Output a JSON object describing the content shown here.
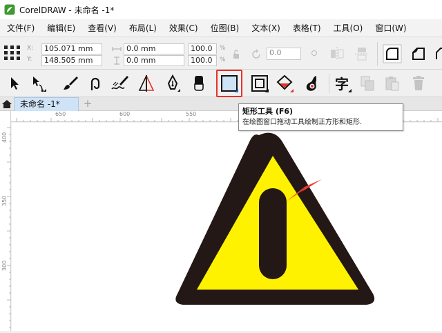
{
  "window": {
    "title": "CorelDRAW - 未命名 -1*",
    "icon": "coreldraw-logo-icon"
  },
  "menu": {
    "items": [
      "文件(F)",
      "编辑(E)",
      "查看(V)",
      "布局(L)",
      "效果(C)",
      "位图(B)",
      "文本(X)",
      "表格(T)",
      "工具(O)",
      "窗口(W)"
    ]
  },
  "property_bar": {
    "x_label": "X:",
    "y_label": "Y:",
    "x_value": "105.071 mm",
    "y_value": "148.505 mm",
    "width_value": "0.0 mm",
    "height_value": "0.0 mm",
    "scale_x": "100.0",
    "scale_y": "100.0",
    "percent": "%",
    "rotation": "0.0"
  },
  "toolbox": {
    "tools": [
      "pick-tool",
      "shape-tool",
      "artistic-media-tool",
      "freehand-tool",
      "calligraphy-tool",
      "smart-fill-tool",
      "pen-tool",
      "eraser-tool",
      "rectangle-tool",
      "contour-tool",
      "interactive-fill-tool",
      "smart-drawing-tool",
      "text-tool",
      "copy-properties-tool",
      "paste-tool",
      "delete-tool"
    ],
    "active_tool": "rectangle-tool",
    "highlight_color": "#e8302a"
  },
  "tabs": {
    "document": "未命名 -1*",
    "add_label": "+"
  },
  "rulers": {
    "horizontal_labels": [
      "650",
      "600",
      "550"
    ],
    "vertical_labels": [
      "400",
      "350",
      "300"
    ]
  },
  "tooltip": {
    "title": "矩形工具 (F6)",
    "description": "在绘图窗口拖动工具绘制正方形和矩形."
  },
  "drawing": {
    "triangle_fill": "#fff200",
    "outline_color": "#231815",
    "arrow_color": "#ee3a36"
  }
}
